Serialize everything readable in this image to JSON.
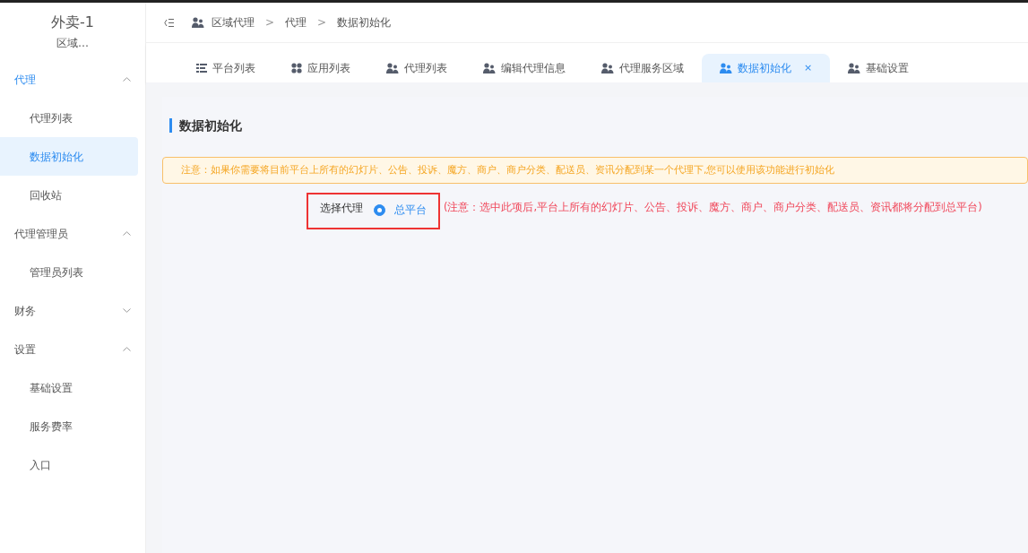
{
  "sidebar": {
    "title": "外卖-1",
    "subtitle": "区域…",
    "groups": [
      {
        "label": "代理",
        "expanded": true,
        "items": [
          {
            "label": "代理列表",
            "selected": false
          },
          {
            "label": "数据初始化",
            "selected": true
          },
          {
            "label": "回收站",
            "selected": false
          }
        ]
      },
      {
        "label": "代理管理员",
        "expanded": true,
        "items": [
          {
            "label": "管理员列表",
            "selected": false
          }
        ]
      },
      {
        "label": "财务",
        "expanded": false
      },
      {
        "label": "设置",
        "expanded": true,
        "items": [
          {
            "label": "基础设置",
            "selected": false
          },
          {
            "label": "服务费率",
            "selected": false
          },
          {
            "label": "入口",
            "selected": false
          }
        ]
      }
    ]
  },
  "breadcrumb": {
    "separator": ">",
    "items": [
      "区域代理",
      "代理",
      "数据初始化"
    ]
  },
  "tabs": [
    {
      "label": "平台列表",
      "kind": "list",
      "selected": false
    },
    {
      "label": "应用列表",
      "kind": "apps",
      "selected": false
    },
    {
      "label": "代理列表",
      "kind": "users",
      "selected": false
    },
    {
      "label": "编辑代理信息",
      "kind": "users",
      "selected": false
    },
    {
      "label": "代理服务区域",
      "kind": "users",
      "selected": false
    },
    {
      "label": "数据初始化",
      "kind": "users",
      "selected": true,
      "close": "×"
    },
    {
      "label": "基础设置",
      "kind": "users",
      "selected": false
    }
  ],
  "page": {
    "title": "数据初始化",
    "notice": "注意：如果你需要将目前平台上所有的幻灯片、公告、投诉、魔方、商户、商户分类、配送员、资讯分配到某一个代理下,您可以使用该功能进行初始化",
    "field_label": "选择代理",
    "options": [
      {
        "label": "总平台",
        "selected": true
      }
    ],
    "hint": "(注意：选中此项后,平台上所有的幻灯片、公告、投诉、魔方、商户、商户分类、配送员、资讯都将分配到总平台)"
  }
}
